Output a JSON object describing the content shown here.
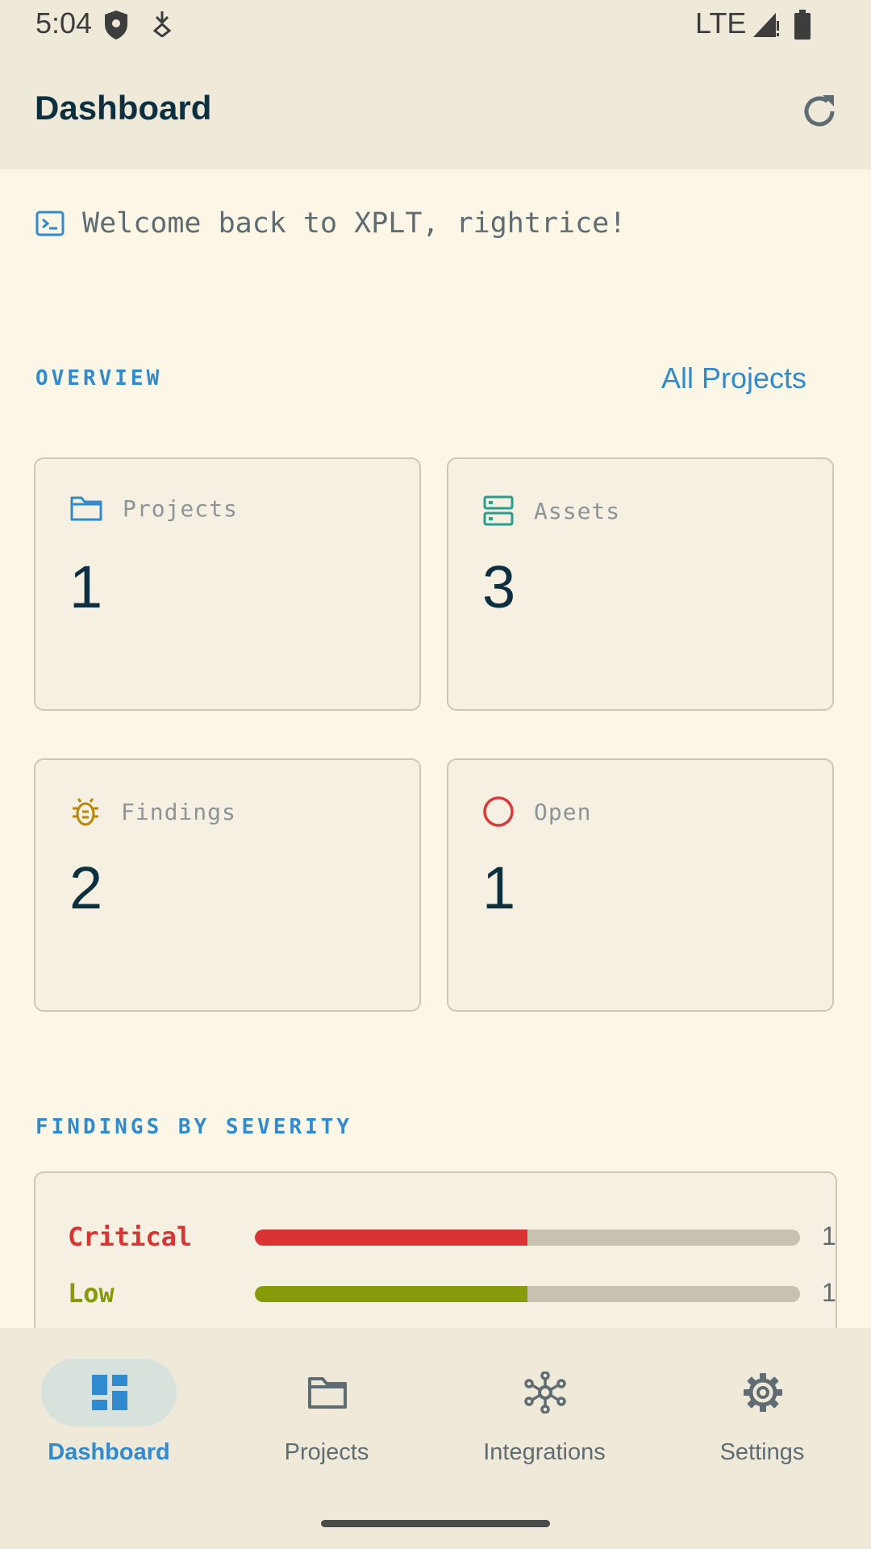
{
  "status_bar": {
    "time": "5:04",
    "network": "LTE"
  },
  "app_bar": {
    "title": "Dashboard",
    "refresh_icon": "refresh-icon"
  },
  "welcome": {
    "text": "Welcome back to XPLT, rightrice!",
    "icon": "terminal-icon"
  },
  "overview": {
    "label": "OVERVIEW",
    "link": "All Projects",
    "cards": [
      {
        "label": "Projects",
        "value": "1",
        "icon": "folder-icon",
        "color": "#2f8ad0"
      },
      {
        "label": "Assets",
        "value": "3",
        "icon": "server-icon",
        "color": "#2a9d8f"
      },
      {
        "label": "Findings",
        "value": "2",
        "icon": "bug-icon",
        "color": "#b8860b"
      },
      {
        "label": "Open",
        "value": "1",
        "icon": "circle-icon",
        "color": "#d93a3a"
      }
    ]
  },
  "severity": {
    "label": "FINDINGS BY SEVERITY",
    "rows": [
      {
        "label": "Critical",
        "count": "1",
        "fraction": 0.5,
        "color": "#d93333"
      },
      {
        "label": "Low",
        "count": "1",
        "fraction": 0.5,
        "color": "#869a0a"
      }
    ]
  },
  "bottom_nav": {
    "items": [
      {
        "label": "Dashboard",
        "icon": "dashboard-icon",
        "active": true
      },
      {
        "label": "Projects",
        "icon": "folder-icon",
        "active": false
      },
      {
        "label": "Integrations",
        "icon": "hub-icon",
        "active": false
      },
      {
        "label": "Settings",
        "icon": "gear-icon",
        "active": false
      }
    ]
  }
}
